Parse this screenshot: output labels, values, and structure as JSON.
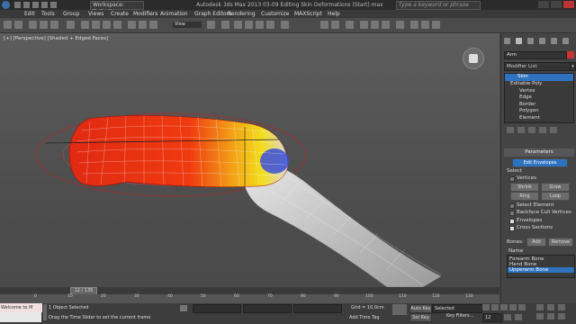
{
  "titlebar": {
    "workspace": "Workspace: Default",
    "app_title": "Autodesk 3ds Max 2013     03-09 Editing Skin Deformations (Start).max",
    "search_placeholder": "Type a keyword or phrase"
  },
  "menu": {
    "items": [
      "Edit",
      "Tools",
      "Group",
      "Views",
      "Create",
      "Modifiers",
      "Animation",
      "Graph Editors",
      "Rendering",
      "Customize",
      "MAXScript",
      "Help"
    ]
  },
  "toolbar": {
    "view_select": "View"
  },
  "viewport": {
    "label": "[+] [Perspective] [Shaded + Edged Faces]"
  },
  "command_panel": {
    "object_name": "Arm",
    "modifier_list": "Modifier List",
    "stack": [
      "Skin",
      "Editable Poly",
      "Vertex",
      "Edge",
      "Border",
      "Polygon",
      "Element"
    ],
    "stack_selected": "Skin",
    "parameters_title": "Parameters",
    "edit_envelopes": "Edit Envelopes",
    "select_label": "Select",
    "vertices_label": "Vertices",
    "shrink": "Shrink",
    "grow": "Grow",
    "ring": "Ring",
    "loop": "Loop",
    "select_element": "Select Element",
    "backface_cull": "Backface Cull Vertices",
    "envelopes": "Envelopes",
    "cross_sections": "Cross Sections",
    "bones_label": "Bones:",
    "add": "Add",
    "remove": "Remove",
    "name_label": "Name",
    "bones": [
      "Forearm Bone",
      "Hand Bone",
      "Upperarm Bone"
    ],
    "bones_selected": "Upperarm Bone"
  },
  "timeline": {
    "frame_display": "12 / 135",
    "ticks": [
      "0",
      "10",
      "20",
      "30",
      "40",
      "50",
      "60",
      "70",
      "80",
      "90",
      "100",
      "110",
      "120",
      "130"
    ]
  },
  "status": {
    "maxscript": "Welcome to M",
    "selection": "1 Object Selected",
    "prompt": "Drag the Time Slider to set the current frame",
    "grid": "Grid = 10,0cm",
    "add_time_tag": "Add Time Tag",
    "auto_key": "Auto Key",
    "selected": "Selected",
    "set_key": "Set Key",
    "key_filters": "Key Filters...",
    "frame_field": "12"
  },
  "colors": {
    "selection_blue": "#2f73c0",
    "object_color": "#cc3333"
  }
}
